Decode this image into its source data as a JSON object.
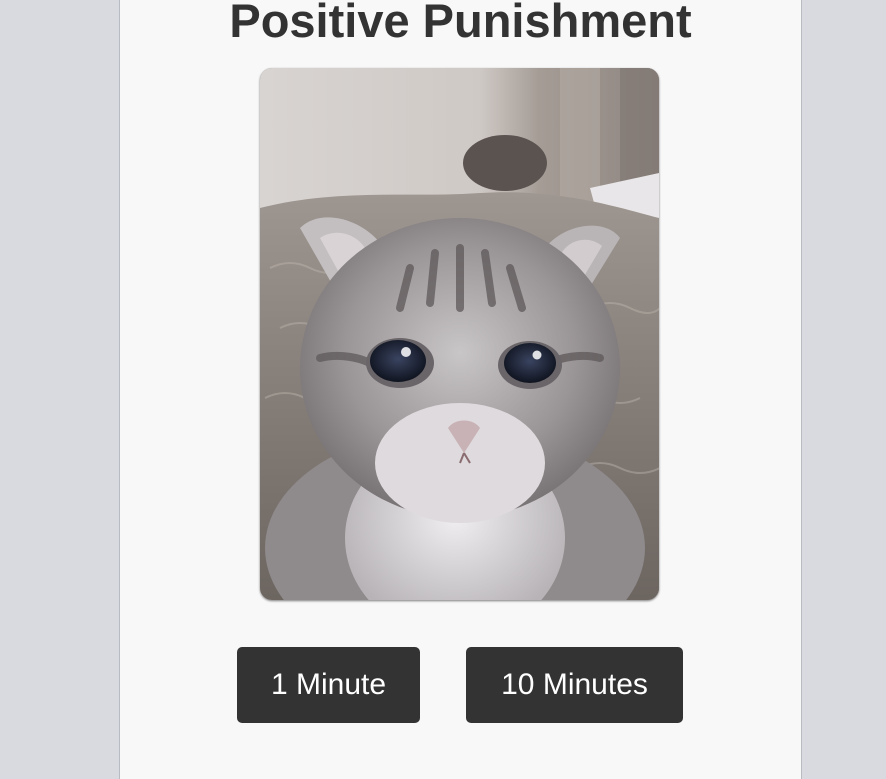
{
  "page": {
    "title": "Positive Punishment"
  },
  "image": {
    "subject": "kitten-photo"
  },
  "buttons": {
    "one_minute": "1 Minute",
    "ten_minutes": "10 Minutes"
  },
  "colors": {
    "background": "#d9dadf",
    "panel": "#f8f8f8",
    "button": "#333333",
    "button_text": "#ffffff",
    "title": "#333333"
  }
}
